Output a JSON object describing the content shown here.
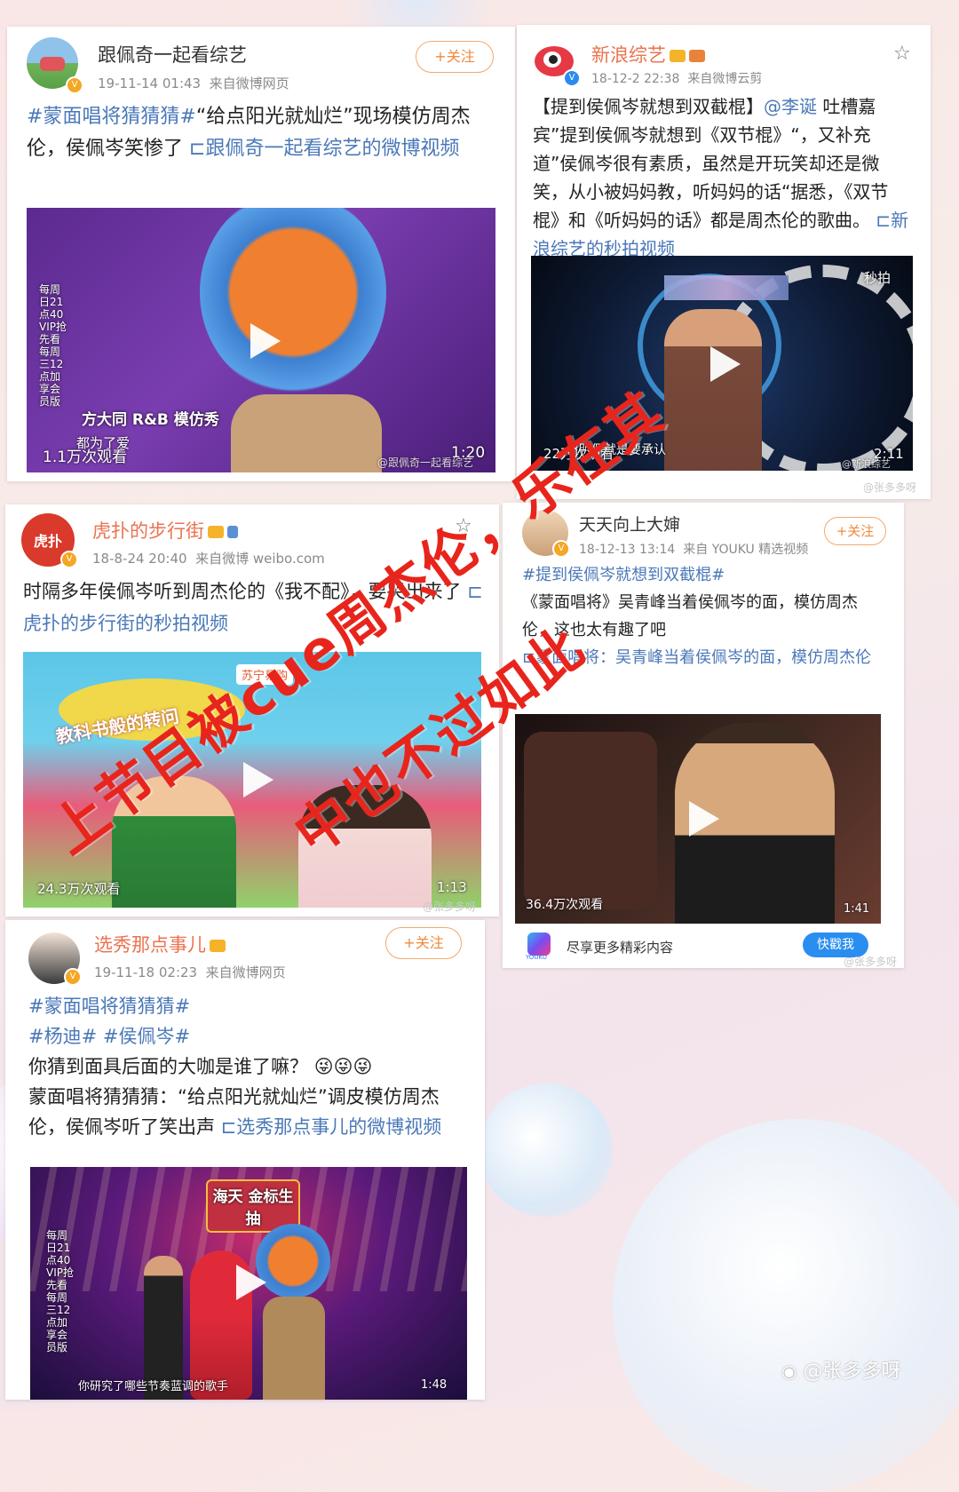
{
  "posts": [
    {
      "username": "跟佩奇一起看综艺",
      "time": "19-11-14 01:43",
      "source": "来自微博网页",
      "follow": "+关注",
      "text_hashtag": "#蒙面唱将猜猜猜#",
      "text_main": "“给点阳光就灿烂”现场模仿周杰伦，侯佩岑笑惨了",
      "text_link": "跟佩奇一起看综艺的微博视频",
      "video": {
        "views": "1.1万次观看",
        "duration": "1:20",
        "caption": "方大同 R&B 模仿秀",
        "subcaption": "都为了爱",
        "side": "每周日21点40 VIP抢先看 每周三12点加享会员版",
        "watermark": "@跟佩奇一起看综艺"
      }
    },
    {
      "username": "新浪综艺",
      "time": "18-12-2 22:38",
      "source": "来自微博云剪",
      "text_main": "【提到侯佩岑就想到双截棍】",
      "text_mention": "@李诞",
      "text_rest": "吐槽嘉宾”提到侯佩岑就想到《双节棍》“，又补充道”侯佩岑很有素质，虽然是开玩笑却还是微笑，从小被妈妈教，听妈妈的话“据悉，《双节棍》和《听妈妈的话》都是周杰伦的歌曲。",
      "text_link": "新浪综艺的秒拍视频",
      "video": {
        "views": "22万次观看",
        "duration": "2:11",
        "caption": "侃明侃就是要承认",
        "logo": "秒拍",
        "watermark": "@新浪综艺"
      },
      "outer_watermark": "@张多多呀"
    },
    {
      "username": "虎扑的步行街",
      "time": "18-8-24 20:40",
      "source": "来自微博 weibo.com",
      "text_main": "时隔多年侯佩岑听到周杰伦的《我不配》，要哭出来了",
      "text_link": "虎扑的步行街的秒拍视频",
      "video": {
        "views": "24.3万次观看",
        "duration": "1:13",
        "caption": "教科书般的转问",
        "badge": "苏宁易购",
        "watermark": "@张多多呀"
      }
    },
    {
      "username": "天天向上大婶",
      "time": "18-12-13 13:14",
      "source": "来自 YOUKU 精选视频",
      "follow": "+关注",
      "text_hashtag": "#提到侯佩岑就想到双截棍#",
      "text_main": "《蒙面唱将》吴青峰当着侯佩岑的面，模仿周杰伦，这也太有趣了吧",
      "text_link": "蒙面唱将：吴青峰当着侯佩岑的面，模仿周杰伦",
      "video": {
        "views": "36.4万次观看",
        "duration": "1:41"
      },
      "footer": {
        "brand": "YOUKU",
        "text": "尽享更多精彩内容",
        "button": "快戳我"
      },
      "outer_watermark": "@张多多呀"
    },
    {
      "username": "选秀那点事儿",
      "time": "19-11-18 02:23",
      "source": "来自微博网页",
      "follow": "+关注",
      "text_hashtag1": "#蒙面唱将猜猜猜#",
      "text_hashtag2": "#杨迪# #侯佩岑#",
      "text_line1": "你猜到面具后面的大咖是谁了嘛？",
      "emoji": "😜😜😜",
      "text_main": "蒙面唱将猜猜猜：“给点阳光就灿烂”调皮模仿周杰伦，侯佩岑听了笑出声",
      "text_link": "选秀那点事儿的微博视频",
      "video": {
        "sign": "海天 金标生抽",
        "subcaption": "你研究了哪些节奏蓝调的歌手",
        "duration": "1:48",
        "side": "每周日21点40 VIP抢先看 每周三12点加享会员版"
      }
    }
  ],
  "overlay": {
    "line1": "上节目被cue周杰伦，乐在其",
    "line2": "中也不过如此",
    "color": "#e8251c"
  },
  "page_watermark": "@张多多呀",
  "colors": {
    "link": "#4a78b8",
    "username": "#eb7350",
    "follow": "#f08a3c"
  }
}
